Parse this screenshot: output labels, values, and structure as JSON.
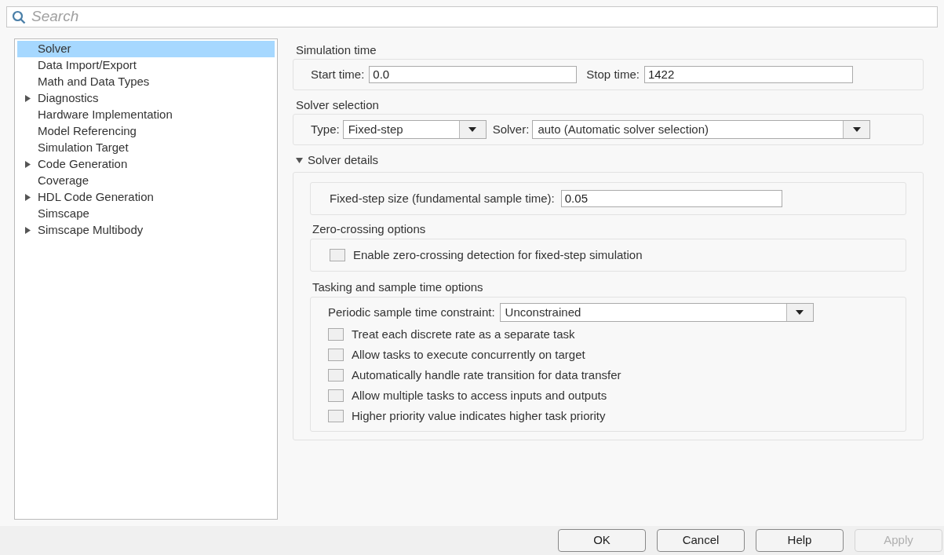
{
  "search": {
    "placeholder": "Search"
  },
  "sidebar": {
    "items": [
      {
        "label": "Solver",
        "kind": "page",
        "selected": true
      },
      {
        "label": "Data Import/Export",
        "kind": "page",
        "selected": false
      },
      {
        "label": "Math and Data Types",
        "kind": "page",
        "selected": false
      },
      {
        "label": "Diagnostics",
        "kind": "group",
        "expanded": false,
        "selected": false
      },
      {
        "label": "Hardware Implementation",
        "kind": "page",
        "selected": false
      },
      {
        "label": "Model Referencing",
        "kind": "page",
        "selected": false
      },
      {
        "label": "Simulation Target",
        "kind": "page",
        "selected": false
      },
      {
        "label": "Code Generation",
        "kind": "group",
        "expanded": false,
        "selected": false
      },
      {
        "label": "Coverage",
        "kind": "page",
        "selected": false
      },
      {
        "label": "HDL Code Generation",
        "kind": "group",
        "expanded": false,
        "selected": false
      },
      {
        "label": "Simscape",
        "kind": "page",
        "selected": false
      },
      {
        "label": "Simscape Multibody",
        "kind": "group",
        "expanded": false,
        "selected": false
      }
    ]
  },
  "simulation_time": {
    "title": "Simulation time",
    "start_label": "Start time:",
    "start_value": "0.0",
    "stop_label": "Stop time:",
    "stop_value": "1422"
  },
  "solver_selection": {
    "title": "Solver selection",
    "type_label": "Type:",
    "type_value": "Fixed-step",
    "solver_label": "Solver:",
    "solver_value": "auto (Automatic solver selection)"
  },
  "solver_details": {
    "title": "Solver details",
    "expanded": true,
    "step_size_label": "Fixed-step size (fundamental sample time):",
    "step_size_value": "0.05",
    "zero_crossing": {
      "title": "Zero-crossing options",
      "options": [
        {
          "label": "Enable zero-crossing detection for fixed-step simulation",
          "checked": false
        }
      ]
    },
    "tasking": {
      "title": "Tasking and sample time options",
      "constraint_label": "Periodic sample time constraint:",
      "constraint_value": "Unconstrained",
      "options": [
        {
          "label": "Treat each discrete rate as a separate task",
          "checked": false
        },
        {
          "label": "Allow tasks to execute concurrently on target",
          "checked": false
        },
        {
          "label": "Automatically handle rate transition for data transfer",
          "checked": false
        },
        {
          "label": "Allow multiple tasks to access inputs and outputs",
          "checked": false
        },
        {
          "label": "Higher priority value indicates higher task priority",
          "checked": false
        }
      ]
    }
  },
  "buttons": [
    {
      "label": "OK",
      "disabled": false
    },
    {
      "label": "Cancel",
      "disabled": false
    },
    {
      "label": "Help",
      "disabled": false
    },
    {
      "label": "Apply",
      "disabled": true
    }
  ]
}
